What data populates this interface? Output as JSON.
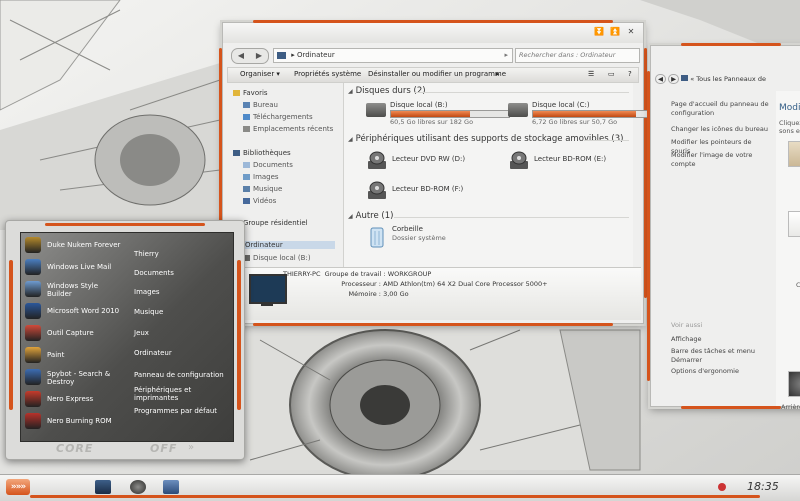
{
  "explorer": {
    "address": {
      "path": "Ordinateur",
      "separator": "▸"
    },
    "search_placeholder": "Rechercher dans : Ordinateur",
    "nav_buttons": [
      "◀",
      "▶"
    ],
    "toolbar": [
      "Organiser ▾",
      "Propriétés système",
      "Désinstaller ou modifier un programme",
      "▸"
    ],
    "nav_pane": [
      {
        "label": "Favoris",
        "icon": "star-icon"
      },
      {
        "label": "Bureau",
        "icon": "desktop-icon"
      },
      {
        "label": "Téléchargements",
        "icon": "downloads-icon"
      },
      {
        "label": "Emplacements récents",
        "icon": "recent-places-icon"
      },
      {
        "label": "Bibliothèques",
        "icon": "libraries-icon"
      },
      {
        "label": "Documents",
        "icon": "documents-icon"
      },
      {
        "label": "Images",
        "icon": "pictures-icon"
      },
      {
        "label": "Musique",
        "icon": "music-icon"
      },
      {
        "label": "Vidéos",
        "icon": "videos-icon"
      },
      {
        "label": "Groupe résidentiel",
        "icon": "homegroup-icon"
      },
      {
        "label": "Ordinateur",
        "icon": "computer-icon"
      },
      {
        "label": "Disque local (B:)",
        "icon": "hard-drive-icon"
      }
    ],
    "groups": {
      "hard_disks": "Disques durs (2)",
      "removable": "Périphériques utilisant des supports de stockage amovibles (3)",
      "other": "Autre (1)"
    },
    "drives": [
      {
        "name": "Disque local (B:)",
        "free": "60,5 Go libres sur 182 Go",
        "used_fraction": 0.67
      },
      {
        "name": "Disque local (C:)",
        "free": "6,72 Go libres sur 50,7 Go",
        "used_fraction": 0.87
      }
    ],
    "removable": [
      {
        "name": "Lecteur DVD RW (D:)"
      },
      {
        "name": "Lecteur BD-ROM (E:)"
      },
      {
        "name": "Lecteur BD-ROM (F:)"
      }
    ],
    "other": [
      {
        "name": "Corbeille",
        "sub": "Dossier système"
      }
    ],
    "details": {
      "pc_name": "THIERRY-PC",
      "workgroup_label": "Groupe de travail :",
      "workgroup": "WORKGROUP",
      "processor_label": "Processeur :",
      "processor": "AMD Athlon(tm) 64 X2 Dual Core Processor 5000+",
      "memory_label": "Mémoire :",
      "memory": "3,00 Go"
    }
  },
  "control_panel": {
    "address": "« Tous les Panneaux de",
    "links": [
      "Page d'accueil du panneau de configuration",
      "Changer les icônes du bureau",
      "Modifier les pointeurs de souris",
      "Modifier l'image de votre compte"
    ],
    "see_also": "Voir aussi",
    "see_also_links": [
      "Affichage",
      "Barre des tâches et menu Démarrer",
      "Options d'ergonomie"
    ],
    "right_title": "Modifi",
    "right_sub": [
      "Cliquez",
      "sons et"
    ],
    "right_captions": [
      "C",
      "Arrière"
    ]
  },
  "start_menu": {
    "programs": [
      {
        "label": "Duke Nukem Forever",
        "icon_color": "#b58a2c"
      },
      {
        "label": "Windows Live Mail",
        "icon_color": "#4a7fc1"
      },
      {
        "label": "Windows Style Builder",
        "icon_color": "#6e9bd0"
      },
      {
        "label": "Microsoft Word 2010",
        "icon_color": "#2b579a"
      },
      {
        "label": "Outil Capture",
        "icon_color": "#d04a3a"
      },
      {
        "label": "Paint",
        "icon_color": "#e0a33c"
      },
      {
        "label": "Spybot - Search & Destroy",
        "icon_color": "#3c6db3"
      },
      {
        "label": "Nero Express",
        "icon_color": "#c63b2b"
      },
      {
        "label": "Nero Burning ROM",
        "icon_color": "#b8322a"
      }
    ],
    "right_links": [
      "Thierry",
      "Documents",
      "Images",
      "Musique",
      "Jeux",
      "Ordinateur",
      "Panneau de configuration",
      "Périphériques et imprimantes",
      "Programmes par défaut"
    ],
    "footer": {
      "core": "CORE",
      "off": "OFF",
      "arrows": "»"
    }
  },
  "taskbar": {
    "start_glyph": "»»»",
    "clock": "18:35"
  },
  "colors": {
    "accent": "#d5541c",
    "selection": "#c9d8e8",
    "link": "#355f87"
  }
}
